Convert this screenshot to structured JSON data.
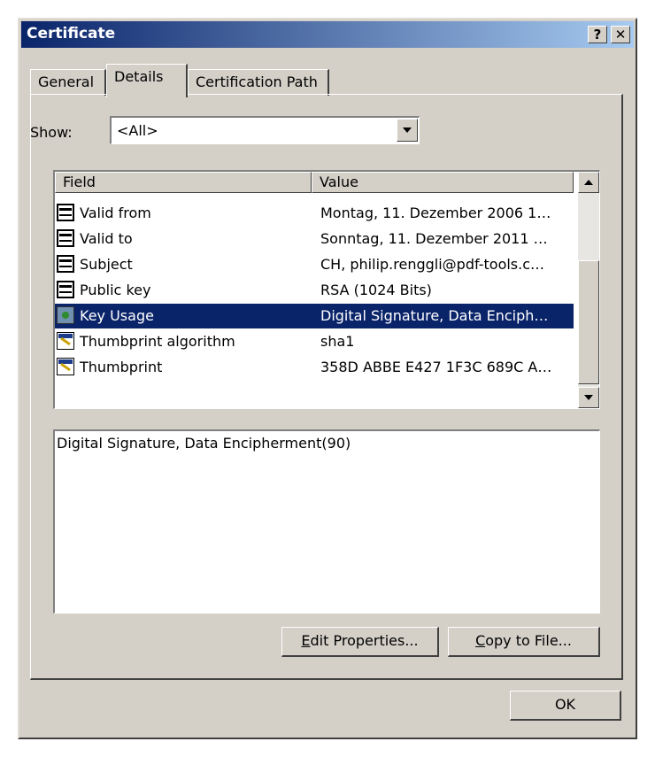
{
  "window": {
    "title": "Certificate",
    "help_label": "?",
    "close_label": "✕"
  },
  "tabs": [
    {
      "label": "General"
    },
    {
      "label": "Details"
    },
    {
      "label": "Certification Path"
    }
  ],
  "show": {
    "label": "Show:",
    "value": "<All>"
  },
  "columns": {
    "field": "Field",
    "value": "Value"
  },
  "rows": [
    {
      "field": "Valid from",
      "value": "Montag, 11. Dezember 2006 1…",
      "icon": "document-icon"
    },
    {
      "field": "Valid to",
      "value": "Sonntag, 11. Dezember 2011 …",
      "icon": "document-icon"
    },
    {
      "field": "Subject",
      "value": "CH, philip.renggli@pdf-tools.c…",
      "icon": "document-icon"
    },
    {
      "field": "Public key",
      "value": "RSA (1024 Bits)",
      "icon": "document-icon"
    },
    {
      "field": "Key Usage",
      "value": "Digital Signature, Data Enciph…",
      "icon": "key-usage-icon"
    },
    {
      "field": "Thumbprint algorithm",
      "value": "sha1",
      "icon": "thumbprint-icon"
    },
    {
      "field": "Thumbprint",
      "value": "358D ABBE E427 1F3C 689C A…",
      "icon": "thumbprint-icon"
    }
  ],
  "selected_row": "Key Usage",
  "detail_text": "Digital Signature, Data Encipherment(90)",
  "buttons": {
    "edit_prefix": "",
    "edit_mnemonic": "E",
    "edit_rest": "dit Properties...",
    "copy_prefix": "",
    "copy_mnemonic": "C",
    "copy_rest": "opy to File...",
    "ok": "OK"
  },
  "colors": {
    "selection": "#0a246a",
    "face": "#d4d0c8"
  }
}
